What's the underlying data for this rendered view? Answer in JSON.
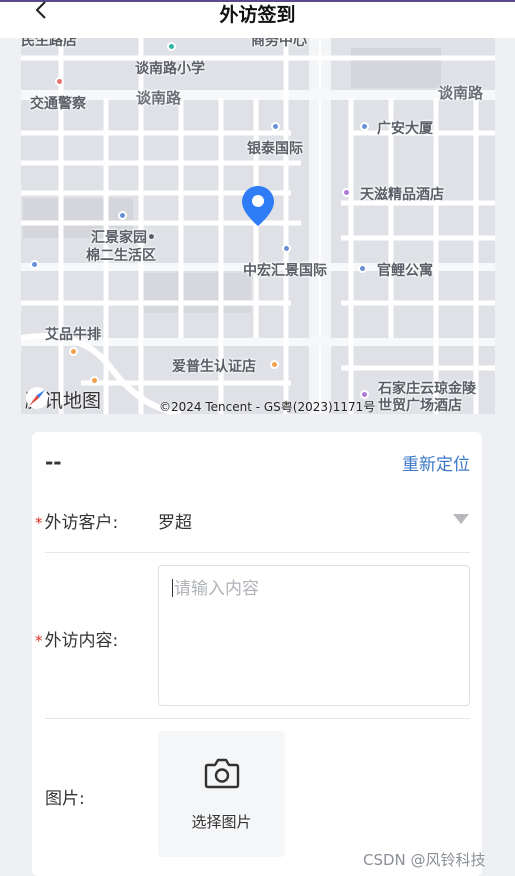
{
  "header": {
    "title": "外访签到",
    "back_icon": "chevron-left-icon"
  },
  "map": {
    "labels": {
      "top_left_cut": "民生路店",
      "top_center_cut": "商务中心",
      "school": "谈南路小学",
      "road_left": "谈南路",
      "road_right": "谈南路",
      "traffic": "交通警察",
      "yintai": "银泰国际",
      "guangan": "广安大厦",
      "tianzi": "天滋精品酒店",
      "huijing_1": "汇景家园•",
      "huijing_2": "棉二生活区",
      "zhonghong": "中宏汇景国际",
      "guanli": "官鲤公寓",
      "aipin": "艾品牛排",
      "aipu": "爱普生认证店",
      "shimao_1": "石家庄云琼金陵",
      "shimao_2": "世贸广场酒店"
    },
    "provider_logo": "腾讯地图",
    "attribution": "©2024 Tencent - GS粤(2023)1171号",
    "pin_color": "#2e7cf6"
  },
  "location": {
    "current": "--",
    "relocate_label": "重新定位"
  },
  "form": {
    "customer": {
      "label": "外访客户:",
      "value": "罗超",
      "required": true
    },
    "content": {
      "label": "外访内容:",
      "placeholder": "请输入内容",
      "required": true
    },
    "image": {
      "label": "图片:",
      "button_label": "选择图片",
      "icon": "camera-icon"
    }
  },
  "watermark": "CSDN @风铃科技",
  "colors": {
    "accent": "#3b78c9",
    "required": "#e0302b"
  }
}
